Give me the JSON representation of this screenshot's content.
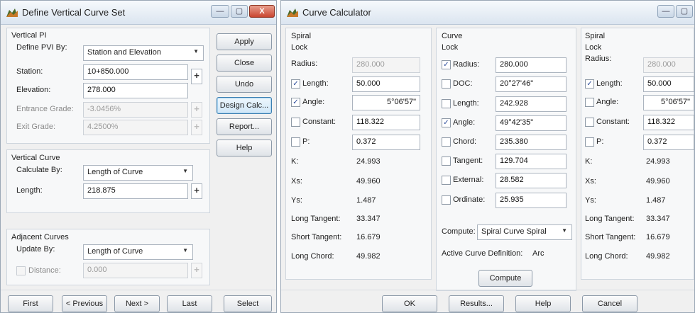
{
  "left": {
    "title": "Define Vertical Curve Set",
    "title_controls": {
      "minimize": "—",
      "maximize": "▢",
      "close": "X"
    },
    "vertical_pi": {
      "heading": "Vertical PI",
      "define_by_label": "Define PVI By:",
      "define_by_value": "Station and Elevation",
      "station_label": "Station:",
      "station_value": "10+850.000",
      "elevation_label": "Elevation:",
      "elevation_value": "278.000",
      "entrance_grade_label": "Entrance Grade:",
      "entrance_grade_value": "-3.0456%",
      "exit_grade_label": "Exit Grade:",
      "exit_grade_value": "4.2500%"
    },
    "vertical_curve": {
      "heading": "Vertical Curve",
      "calculate_by_label": "Calculate By:",
      "calculate_by_value": "Length of Curve",
      "length_label": "Length:",
      "length_value": "218.875"
    },
    "adjacent_curves": {
      "heading": "Adjacent Curves",
      "update_by_label": "Update By:",
      "update_by_value": "Length of Curve",
      "distance_label": "Distance:",
      "distance_value": "0.000"
    },
    "buttons": {
      "apply": "Apply",
      "close": "Close",
      "undo": "Undo",
      "design_calc": "Design Calc...",
      "report": "Report...",
      "help": "Help"
    },
    "bottom_buttons": {
      "first": "First",
      "previous": "< Previous",
      "next": "Next >",
      "last": "Last",
      "select": "Select"
    },
    "spin_glyph": "+"
  },
  "right": {
    "title": "Curve Calculator",
    "title_controls": {
      "minimize": "—",
      "maximize": "▢"
    },
    "check_glyph": "✓",
    "spiral_left": {
      "heading": "Spiral",
      "lock": "Lock",
      "radius_label": "Radius:",
      "radius_value": "280.000",
      "length_label": "Length:",
      "length_value": "50.000",
      "angle_label": "Angle:",
      "angle_value": "5°06'57\"",
      "constant_label": "Constant:",
      "constant_value": "118.322",
      "p_label": "P:",
      "p_value": "0.372",
      "k_label": "K:",
      "k_value": "24.993",
      "xs_label": "Xs:",
      "xs_value": "49.960",
      "ys_label": "Ys:",
      "ys_value": "1.487",
      "long_tangent_label": "Long Tangent:",
      "long_tangent_value": "33.347",
      "short_tangent_label": "Short Tangent:",
      "short_tangent_value": "16.679",
      "long_chord_label": "Long Chord:",
      "long_chord_value": "49.982"
    },
    "curve": {
      "heading": "Curve",
      "lock": "Lock",
      "radius_label": "Radius:",
      "radius_value": "280.000",
      "doc_label": "DOC:",
      "doc_value": "20°27'46\"",
      "length_label": "Length:",
      "length_value": "242.928",
      "angle_label": "Angle:",
      "angle_value": "49°42'35\"",
      "chord_label": "Chord:",
      "chord_value": "235.380",
      "tangent_label": "Tangent:",
      "tangent_value": "129.704",
      "external_label": "External:",
      "external_value": "28.582",
      "ordinate_label": "Ordinate:",
      "ordinate_value": "25.935",
      "compute_label": "Compute:",
      "compute_value": "Spiral Curve Spiral",
      "active_def_label": "Active Curve Definition:",
      "active_def_value": "Arc",
      "compute_button": "Compute"
    },
    "spiral_right": {
      "heading": "Spiral",
      "lock": "Lock",
      "radius_label": "Radius:",
      "radius_value": "280.000",
      "length_label": "Length:",
      "length_value": "50.000",
      "angle_label": "Angle:",
      "angle_value": "5°06'57\"",
      "constant_label": "Constant:",
      "constant_value": "118.322",
      "p_label": "P:",
      "p_value": "0.372",
      "k_label": "K:",
      "k_value": "24.993",
      "xs_label": "Xs:",
      "xs_value": "49.960",
      "ys_label": "Ys:",
      "ys_value": "1.487",
      "long_tangent_label": "Long Tangent:",
      "long_tangent_value": "33.347",
      "short_tangent_label": "Short Tangent:",
      "short_tangent_value": "16.679",
      "long_chord_label": "Long Chord:",
      "long_chord_value": "49.982"
    },
    "bottom_buttons": {
      "ok": "OK",
      "results": "Results...",
      "help": "Help",
      "cancel": "Cancel"
    }
  }
}
